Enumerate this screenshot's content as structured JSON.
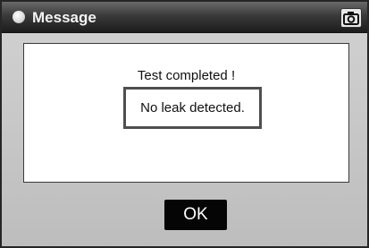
{
  "window": {
    "title": "Message"
  },
  "icons": {
    "title": "circle-icon",
    "snapshot": "camera-icon"
  },
  "message": {
    "headline": "Test completed !",
    "result": "No leak detected."
  },
  "buttons": {
    "ok_label": "OK"
  },
  "colors": {
    "titlebar": "#2a2a2a",
    "panel": "#ffffff",
    "ok_button": "#050505"
  }
}
